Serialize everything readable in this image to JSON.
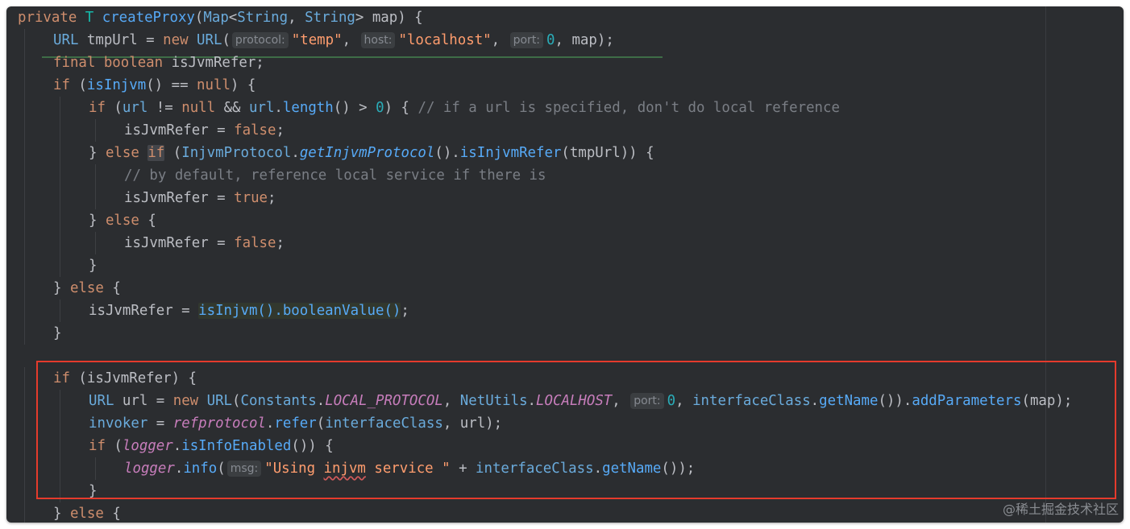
{
  "editor": {
    "theme": {
      "background": "#2b2d30",
      "keyword": "#cf8e6d",
      "string": "#6aab73",
      "comment": "#7a7e85",
      "number": "#2aacb8",
      "highlight_box": "#e53b2c"
    },
    "lines": [
      [
        [
          "kw",
          "private "
        ],
        [
          "tp",
          "T "
        ],
        [
          "fn",
          "createProxy"
        ],
        [
          "plain",
          "("
        ],
        [
          "ty",
          "Map"
        ],
        [
          "plain",
          "<"
        ],
        [
          "ty",
          "String"
        ],
        [
          "plain",
          ", "
        ],
        [
          "ty",
          "String"
        ],
        [
          "plain",
          "> map) {"
        ]
      ],
      [
        [
          "ty",
          "URL"
        ],
        [
          "plain",
          " tmpUrl = "
        ],
        [
          "kw",
          "new "
        ],
        [
          "ty",
          "URL"
        ],
        [
          "plain",
          "("
        ],
        [
          "hint",
          "protocol:"
        ],
        [
          "str2",
          "\"temp\""
        ],
        [
          "plain",
          ", "
        ],
        [
          "hint",
          "host:"
        ],
        [
          "str2",
          "\"localhost\""
        ],
        [
          "plain",
          ", "
        ],
        [
          "hint",
          "port:"
        ],
        [
          "num",
          "0"
        ],
        [
          "plain",
          ", map);"
        ]
      ],
      [
        [
          "kw",
          "final boolean "
        ],
        [
          "plain",
          "isJvmRefer;"
        ]
      ],
      [
        [
          "kw",
          "if "
        ],
        [
          "plain",
          "("
        ],
        [
          "call",
          "isInjvm"
        ],
        [
          "plain",
          "() == "
        ],
        [
          "kw",
          "null"
        ],
        [
          "plain",
          ") {"
        ]
      ],
      [
        [
          "kw",
          "if "
        ],
        [
          "plain",
          "("
        ],
        [
          "ty",
          "url"
        ],
        [
          "plain",
          " != "
        ],
        [
          "kw",
          "null"
        ],
        [
          "plain",
          " && "
        ],
        [
          "ty",
          "url"
        ],
        [
          "plain",
          "."
        ],
        [
          "call",
          "length"
        ],
        [
          "plain",
          "() > "
        ],
        [
          "num",
          "0"
        ],
        [
          "plain",
          ") { "
        ],
        [
          "cm",
          "// if a url is specified, don't do local reference"
        ]
      ],
      [
        [
          "plain",
          "isJvmRefer = "
        ],
        [
          "kw",
          "false"
        ],
        [
          "plain",
          ";"
        ]
      ],
      [
        [
          "plain",
          "} "
        ],
        [
          "kw",
          "else "
        ],
        [
          "kwhl",
          "if"
        ],
        [
          "plain",
          " ("
        ],
        [
          "ty",
          "InjvmProtocol"
        ],
        [
          "plain",
          "."
        ],
        [
          "callit",
          "getInjvmProtocol"
        ],
        [
          "plain",
          "()."
        ],
        [
          "call",
          "isInjvmRefer"
        ],
        [
          "plain",
          "(tmpUrl)) {"
        ]
      ],
      [
        [
          "cm",
          "// by default, reference local service if there is"
        ]
      ],
      [
        [
          "plain",
          "isJvmRefer = "
        ],
        [
          "kw",
          "true"
        ],
        [
          "plain",
          ";"
        ]
      ],
      [
        [
          "plain",
          "} "
        ],
        [
          "kw",
          "else "
        ],
        [
          "plain",
          "{"
        ]
      ],
      [
        [
          "plain",
          "isJvmRefer = "
        ],
        [
          "kw",
          "false"
        ],
        [
          "plain",
          ";"
        ]
      ],
      [
        [
          "plain",
          "}"
        ]
      ],
      [
        [
          "plain",
          "} "
        ],
        [
          "kw",
          "else "
        ],
        [
          "plain",
          "{"
        ]
      ],
      [
        [
          "plain",
          "isJvmRefer = "
        ],
        [
          "exprhl",
          "isInjvm().booleanValue()"
        ],
        [
          "plain",
          ";"
        ]
      ],
      [
        [
          "plain",
          "}"
        ]
      ],
      [],
      [
        [
          "kw",
          "if "
        ],
        [
          "plain",
          "(isJvmRefer) {"
        ]
      ],
      [
        [
          "ty",
          "URL"
        ],
        [
          "plain",
          " url = "
        ],
        [
          "kw",
          "new "
        ],
        [
          "ty",
          "URL"
        ],
        [
          "plain",
          "("
        ],
        [
          "ty",
          "Constants"
        ],
        [
          "plain",
          "."
        ],
        [
          "const",
          "LOCAL_PROTOCOL"
        ],
        [
          "plain",
          ", "
        ],
        [
          "ty",
          "NetUtils"
        ],
        [
          "plain",
          "."
        ],
        [
          "const",
          "LOCALHOST"
        ],
        [
          "plain",
          ", "
        ],
        [
          "hint",
          "port:"
        ],
        [
          "num",
          "0"
        ],
        [
          "plain",
          ", "
        ],
        [
          "ty",
          "interfaceClass"
        ],
        [
          "plain",
          "."
        ],
        [
          "call",
          "getName"
        ],
        [
          "plain",
          "())."
        ],
        [
          "call",
          "addParameters"
        ],
        [
          "plain",
          "(map);"
        ]
      ],
      [
        [
          "ty",
          "invoker"
        ],
        [
          "plain",
          " = "
        ],
        [
          "field",
          "refprotocol"
        ],
        [
          "plain",
          "."
        ],
        [
          "call",
          "refer"
        ],
        [
          "plain",
          "("
        ],
        [
          "ty",
          "interfaceClass"
        ],
        [
          "plain",
          ", url);"
        ]
      ],
      [
        [
          "kw",
          "if "
        ],
        [
          "plain",
          "("
        ],
        [
          "field",
          "logger"
        ],
        [
          "plain",
          "."
        ],
        [
          "call",
          "isInfoEnabled"
        ],
        [
          "plain",
          "()) {"
        ]
      ],
      [
        [
          "field",
          "logger"
        ],
        [
          "plain",
          "."
        ],
        [
          "call",
          "info"
        ],
        [
          "plain",
          "("
        ],
        [
          "hint",
          "msg:"
        ],
        [
          "str2",
          "\"Using "
        ],
        [
          "sq",
          "injvm"
        ],
        [
          "str2",
          " service \""
        ],
        [
          "plain",
          " + "
        ],
        [
          "ty",
          "interfaceClass"
        ],
        [
          "plain",
          "."
        ],
        [
          "call",
          "getName"
        ],
        [
          "plain",
          "());"
        ]
      ],
      [
        [
          "plain",
          "}"
        ]
      ],
      [
        [
          "plain",
          "} "
        ],
        [
          "kw",
          "else "
        ],
        [
          "plain",
          "{"
        ]
      ]
    ],
    "indents": [
      0,
      1,
      1,
      1,
      2,
      3,
      2,
      3,
      3,
      2,
      3,
      2,
      1,
      2,
      1,
      0,
      1,
      2,
      2,
      2,
      3,
      2,
      1
    ]
  },
  "watermark": "@稀土掘金技术社区"
}
